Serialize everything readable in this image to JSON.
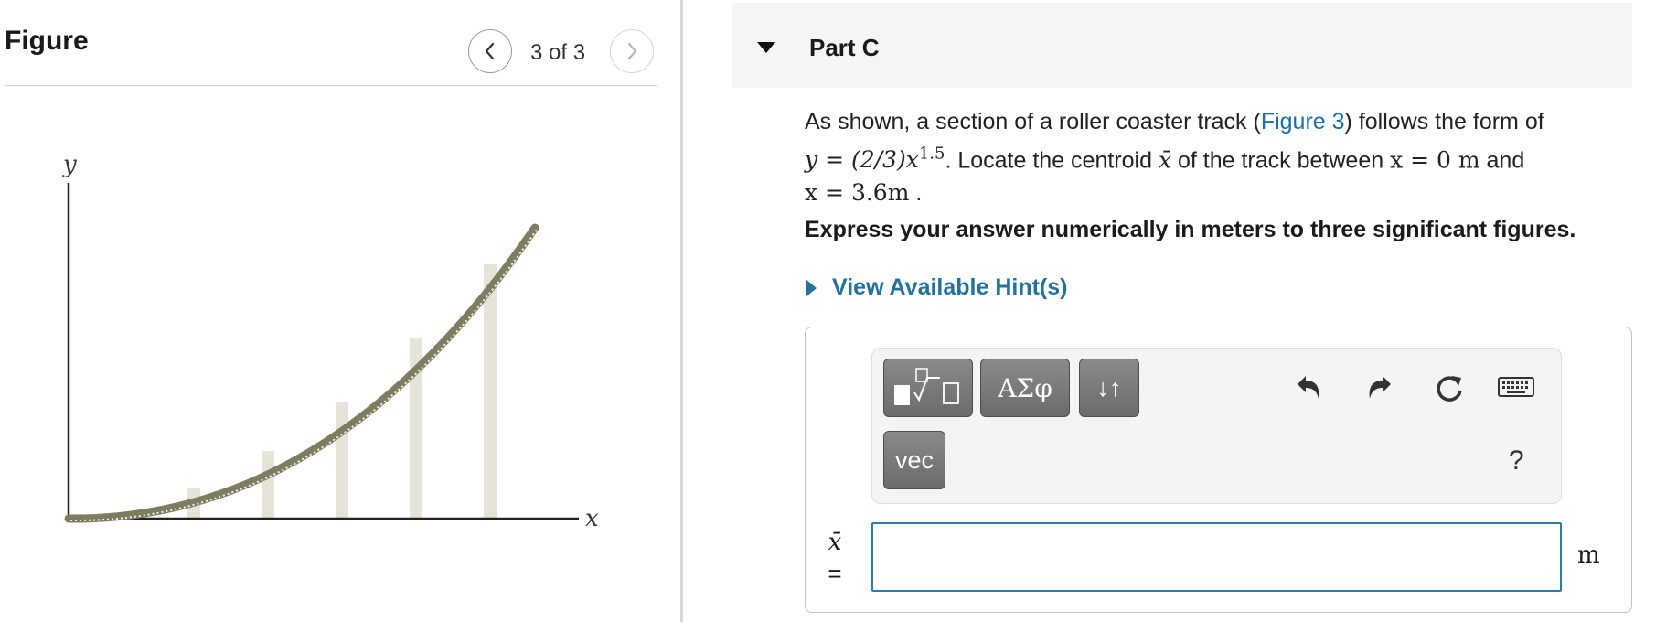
{
  "figure": {
    "title": "Figure",
    "counter": "3 of 3",
    "axis_x_label": "x",
    "axis_y_label": "y"
  },
  "part": {
    "title": "Part C",
    "question": {
      "prefix": "As shown, a section of a roller coaster track (",
      "link": "Figure 3",
      "mid1": ") follows the form of",
      "equation": "y = (2/3)x",
      "exponent": "1.5",
      "mid2": ". Locate the centroid ",
      "centroid_symbol": "x̄",
      "mid3": " of the track between ",
      "bound_start": "x = 0 m",
      "mid4": " and",
      "bound_end": "x = 3.6m",
      "suffix": " ."
    },
    "instructions": "Express your answer numerically in meters to three significant figures.",
    "hint_label": "View Available Hint(s)"
  },
  "answer": {
    "toolbar": {
      "greek_label": "ΑΣφ",
      "arrows_label": "↓↑",
      "vec_label": "vec",
      "help_label": "?"
    },
    "variable": "x̄",
    "equals": "=",
    "input_value": "",
    "unit": "m"
  },
  "colors": {
    "link": "#1a6ea8",
    "hint": "#23719f",
    "input_border": "#2a7bb0",
    "track": "#7d7d62",
    "support": "#e6e3d8"
  }
}
